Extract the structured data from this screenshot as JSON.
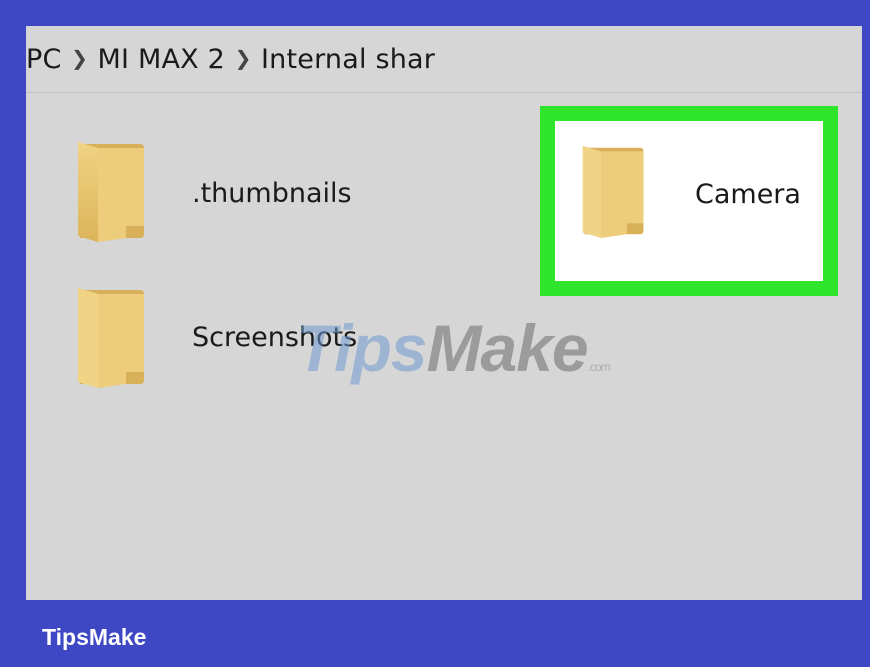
{
  "breadcrumb": {
    "items": [
      "PC",
      "MI MAX 2",
      "Internal shar"
    ]
  },
  "folders": [
    {
      "name": ".thumbnails",
      "icon": "folder-icon"
    },
    {
      "name": "Camera",
      "icon": "folder-icon",
      "highlighted": true
    },
    {
      "name": "Screenshots",
      "icon": "folder-icon"
    }
  ],
  "watermark": {
    "part1": "Tips",
    "part2": "Make",
    "suffix": ".com"
  },
  "brand": "TipsMake",
  "colors": {
    "frame": "#3f48c4",
    "panel": "#d6d6d6",
    "highlight_border": "#2ee52c",
    "folder": "#e8c46a"
  }
}
